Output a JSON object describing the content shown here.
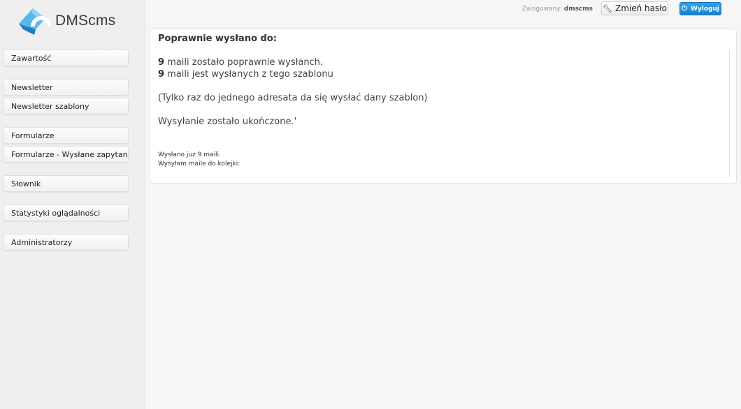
{
  "brand": {
    "name": "DMScms"
  },
  "sidebar": {
    "items": [
      {
        "label": "Zawartość"
      },
      {
        "label": "Newsletter"
      },
      {
        "label": "Newsletter szablony"
      },
      {
        "label": "Formularze"
      },
      {
        "label": "Formularze - Wysłane zapytania"
      },
      {
        "label": "Słownik"
      },
      {
        "label": "Statystyki oglądalności"
      },
      {
        "label": "Administratorzy"
      }
    ]
  },
  "header": {
    "logged_label": "Zalogowany:",
    "username": "dmscms",
    "change_password": "Zmień hasło",
    "logout": "Wyloguj"
  },
  "content": {
    "title": "Poprawnie wysłano do:",
    "sent_count": "9",
    "sent_text": " maili zostało poprawnie wysłanch.",
    "template_count": "9",
    "template_text": " maili jest wysłanych z tego szablonu",
    "note": "(Tylko raz do jednego adresata da się wysłać dany szablon)",
    "finished": "Wysyłanie zostało ukończone.'",
    "status_sent": "Wysłano juz 9 maili.",
    "status_queue": "Wysyłam maile do kolejki:"
  },
  "colors": {
    "accent": "#1a87d4",
    "logo_blue": "#2a9be0"
  }
}
